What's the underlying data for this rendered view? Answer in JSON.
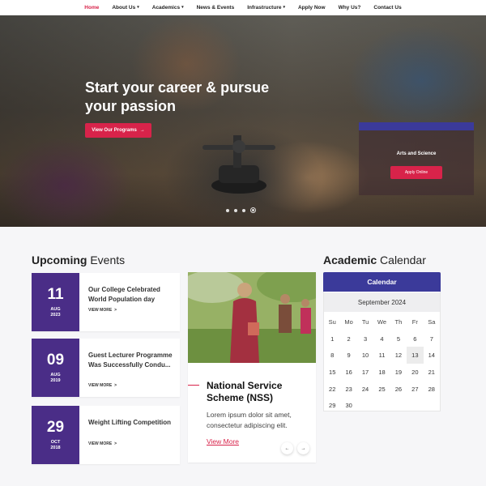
{
  "nav": {
    "items": [
      {
        "label": "Home",
        "active": true,
        "dropdown": false
      },
      {
        "label": "About Us",
        "active": false,
        "dropdown": true
      },
      {
        "label": "Academics",
        "active": false,
        "dropdown": true
      },
      {
        "label": "News & Events",
        "active": false,
        "dropdown": false
      },
      {
        "label": "Infrastructure",
        "active": false,
        "dropdown": true
      },
      {
        "label": "Apply Now",
        "active": false,
        "dropdown": false
      },
      {
        "label": "Why Us?",
        "active": false,
        "dropdown": false
      },
      {
        "label": "Contact Us",
        "active": false,
        "dropdown": false
      }
    ]
  },
  "hero": {
    "title": "Start your career & pursue your passion",
    "button_label": "View Our Programs",
    "card_title": "Arts and Science",
    "card_button": "Apply Online",
    "slides": 4,
    "active_slide": 4
  },
  "events": {
    "title_bold": "Upcoming",
    "title_light": "Events",
    "items": [
      {
        "day": "11",
        "month": "AUG",
        "year": "2023",
        "title": "Our College Celebrated World Population day",
        "more": "VIEW MORE"
      },
      {
        "day": "09",
        "month": "AUG",
        "year": "2019",
        "title": "Guest Lecturer Programme Was Successfully Condu...",
        "more": "VIEW MORE"
      },
      {
        "day": "29",
        "month": "OCT",
        "year": "2018",
        "title": "Weight Lifting Competition",
        "more": "VIEW MORE"
      }
    ]
  },
  "feature": {
    "title": "National Service Scheme (NSS)",
    "text": "Lorem ipsum dolor sit amet, consectetur adipiscing elit.",
    "link": "View More"
  },
  "calendar": {
    "title_bold": "Academic",
    "title_light": "Calendar",
    "header": "Calendar",
    "month": "September 2024",
    "weekdays": [
      "Su",
      "Mo",
      "Tu",
      "We",
      "Th",
      "Fr",
      "Sa"
    ],
    "leading_blanks": 0,
    "days_in_month": 30,
    "today": 13
  },
  "colors": {
    "accent": "#d8234a",
    "purple": "#4a2d87",
    "indigo": "#3b3a9a"
  }
}
